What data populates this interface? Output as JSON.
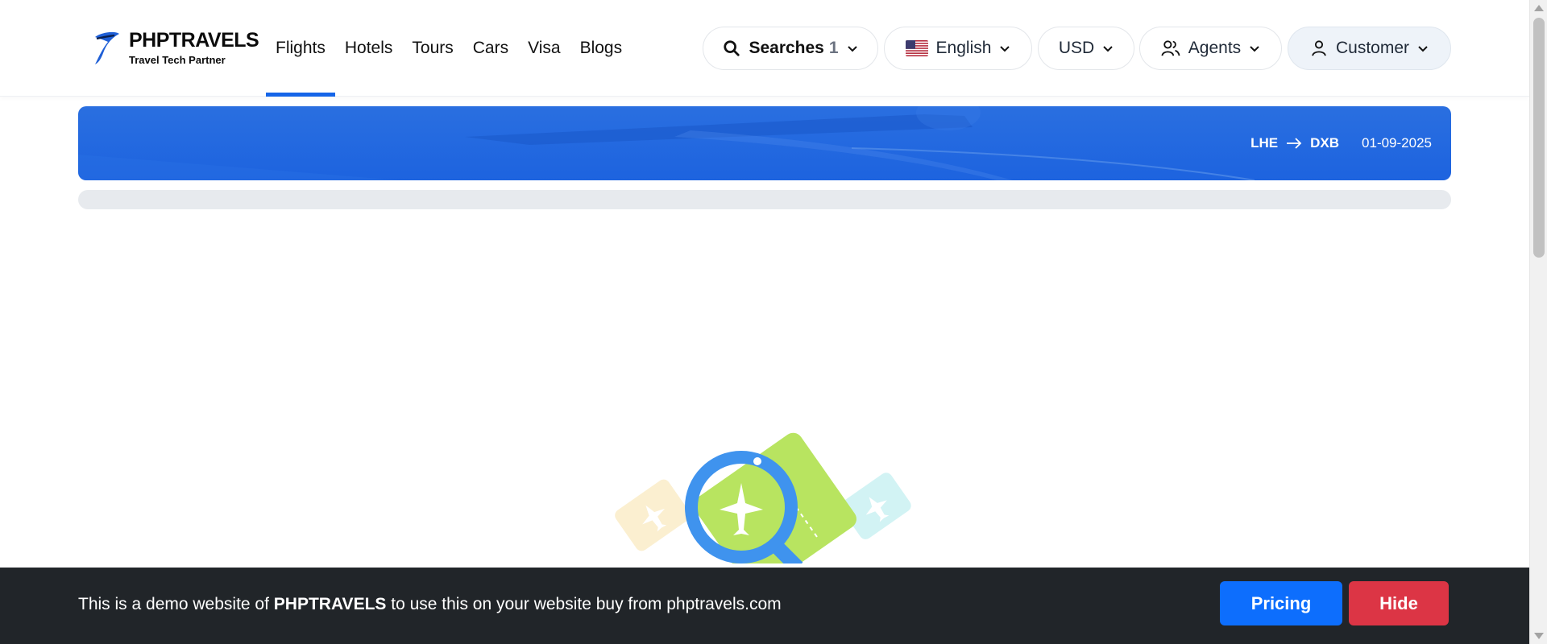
{
  "header": {
    "logo": {
      "title": "PHPTRAVELS",
      "subtitle": "Travel Tech Partner"
    },
    "nav": [
      {
        "label": "Flights",
        "active": true
      },
      {
        "label": "Hotels"
      },
      {
        "label": "Tours"
      },
      {
        "label": "Cars"
      },
      {
        "label": "Visa"
      },
      {
        "label": "Blogs"
      }
    ],
    "searches": {
      "label": "Searches",
      "count": "1",
      "icon": "search-icon"
    },
    "language": {
      "label": "English",
      "flag": "us-flag-icon"
    },
    "currency": {
      "label": "USD"
    },
    "agents": {
      "label": "Agents",
      "icon": "users-icon"
    },
    "customer": {
      "label": "Customer",
      "icon": "user-icon"
    }
  },
  "banner": {
    "from": "LHE",
    "to": "DXB",
    "date": "01-09-2025"
  },
  "demo_bar": {
    "text_before": "This is a demo website of ",
    "brand": "PHPTRAVELS",
    "text_after": " to use this on your website buy from phptravels.com",
    "pricing_label": "Pricing",
    "hide_label": "Hide"
  },
  "colors": {
    "accent": "#1565e8",
    "banner": "#1d63df",
    "pricing": "#0d6efd",
    "hide": "#dc3545",
    "demo_bar": "#212529"
  }
}
